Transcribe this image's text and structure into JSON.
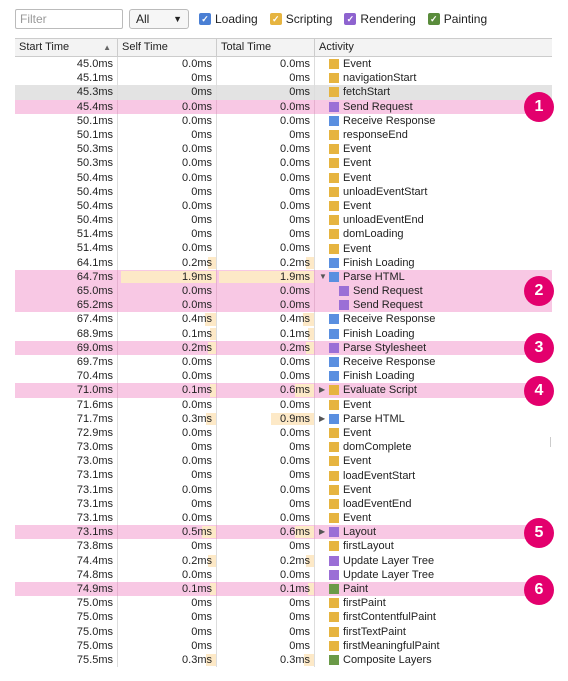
{
  "toolbar": {
    "filter_placeholder": "Filter",
    "select_value": "All",
    "categories": [
      {
        "label": "Loading",
        "color": "#4a7fd4"
      },
      {
        "label": "Scripting",
        "color": "#e6b440"
      },
      {
        "label": "Rendering",
        "color": "#8e63cf"
      },
      {
        "label": "Painting",
        "color": "#5a8c3c"
      }
    ]
  },
  "columns": {
    "start": "Start Time",
    "self": "Self Time",
    "total": "Total Time",
    "activity": "Activity"
  },
  "rows": [
    {
      "start": "45.0ms",
      "self": "0.0ms",
      "total": "0.0ms",
      "activity": "Event",
      "cat": "scripting"
    },
    {
      "start": "45.1ms",
      "self": "0ms",
      "total": "0ms",
      "activity": "navigationStart",
      "cat": "scripting"
    },
    {
      "start": "45.3ms",
      "self": "0ms",
      "total": "0ms",
      "activity": "fetchStart",
      "cat": "scripting",
      "sel": true
    },
    {
      "start": "45.4ms",
      "self": "0.0ms",
      "total": "0.0ms",
      "activity": "Send Request",
      "cat": "rendering",
      "hl": true
    },
    {
      "start": "50.1ms",
      "self": "0.0ms",
      "total": "0.0ms",
      "activity": "Receive Response",
      "cat": "loading"
    },
    {
      "start": "50.1ms",
      "self": "0ms",
      "total": "0ms",
      "activity": "responseEnd",
      "cat": "scripting"
    },
    {
      "start": "50.3ms",
      "self": "0.0ms",
      "total": "0.0ms",
      "activity": "Event",
      "cat": "scripting"
    },
    {
      "start": "50.3ms",
      "self": "0.0ms",
      "total": "0.0ms",
      "activity": "Event",
      "cat": "scripting"
    },
    {
      "start": "50.4ms",
      "self": "0.0ms",
      "total": "0.0ms",
      "activity": "Event",
      "cat": "scripting"
    },
    {
      "start": "50.4ms",
      "self": "0ms",
      "total": "0ms",
      "activity": "unloadEventStart",
      "cat": "scripting"
    },
    {
      "start": "50.4ms",
      "self": "0.0ms",
      "total": "0.0ms",
      "activity": "Event",
      "cat": "scripting"
    },
    {
      "start": "50.4ms",
      "self": "0ms",
      "total": "0ms",
      "activity": "unloadEventEnd",
      "cat": "scripting"
    },
    {
      "start": "51.4ms",
      "self": "0ms",
      "total": "0ms",
      "activity": "domLoading",
      "cat": "scripting"
    },
    {
      "start": "51.4ms",
      "self": "0.0ms",
      "total": "0.0ms",
      "activity": "Event",
      "cat": "scripting"
    },
    {
      "start": "64.1ms",
      "self": "0.2ms",
      "total": "0.2ms",
      "activity": "Finish Loading",
      "cat": "loading",
      "bar": 0.08
    },
    {
      "start": "64.7ms",
      "self": "1.9ms",
      "total": "1.9ms",
      "activity": "Parse HTML",
      "cat": "loading",
      "hl": true,
      "tri": "▼",
      "bar": 1.0
    },
    {
      "start": "65.0ms",
      "self": "0.0ms",
      "total": "0.0ms",
      "activity": "Send Request",
      "cat": "rendering",
      "hl": true,
      "indent": true
    },
    {
      "start": "65.2ms",
      "self": "0.0ms",
      "total": "0.0ms",
      "activity": "Send Request",
      "cat": "rendering",
      "hl": true,
      "indent": true
    },
    {
      "start": "67.4ms",
      "self": "0.4ms",
      "total": "0.4ms",
      "activity": "Receive Response",
      "cat": "loading",
      "bar": 0.12
    },
    {
      "start": "68.9ms",
      "self": "0.1ms",
      "total": "0.1ms",
      "activity": "Finish Loading",
      "cat": "loading",
      "bar": 0.05
    },
    {
      "start": "69.0ms",
      "self": "0.2ms",
      "total": "0.2ms",
      "activity": "Parse Stylesheet",
      "cat": "rendering",
      "hl": true,
      "bar": 0.08
    },
    {
      "start": "69.7ms",
      "self": "0.0ms",
      "total": "0.0ms",
      "activity": "Receive Response",
      "cat": "loading"
    },
    {
      "start": "70.4ms",
      "self": "0.0ms",
      "total": "0.0ms",
      "activity": "Finish Loading",
      "cat": "loading"
    },
    {
      "start": "71.0ms",
      "self": "0.1ms",
      "total": "0.6ms",
      "activity": "Evaluate Script",
      "cat": "scripting",
      "hl": true,
      "tri": "▶",
      "bar": 0.05,
      "tbar": 0.2
    },
    {
      "start": "71.6ms",
      "self": "0.0ms",
      "total": "0.0ms",
      "activity": "Event",
      "cat": "scripting"
    },
    {
      "start": "71.7ms",
      "self": "0.3ms",
      "total": "0.9ms",
      "activity": "Parse HTML",
      "cat": "loading",
      "tri": "▶",
      "bar": 0.1,
      "tbar": 0.45
    },
    {
      "start": "72.9ms",
      "self": "0.0ms",
      "total": "0.0ms",
      "activity": "Event",
      "cat": "scripting"
    },
    {
      "start": "73.0ms",
      "self": "0ms",
      "total": "0ms",
      "activity": "domComplete",
      "cat": "scripting"
    },
    {
      "start": "73.0ms",
      "self": "0.0ms",
      "total": "0.0ms",
      "activity": "Event",
      "cat": "scripting"
    },
    {
      "start": "73.1ms",
      "self": "0ms",
      "total": "0ms",
      "activity": "loadEventStart",
      "cat": "scripting"
    },
    {
      "start": "73.1ms",
      "self": "0.0ms",
      "total": "0.0ms",
      "activity": "Event",
      "cat": "scripting"
    },
    {
      "start": "73.1ms",
      "self": "0ms",
      "total": "0ms",
      "activity": "loadEventEnd",
      "cat": "scripting"
    },
    {
      "start": "73.1ms",
      "self": "0.0ms",
      "total": "0.0ms",
      "activity": "Event",
      "cat": "scripting"
    },
    {
      "start": "73.1ms",
      "self": "0.5ms",
      "total": "0.6ms",
      "activity": "Layout",
      "cat": "rendering",
      "hl": true,
      "tri": "▶",
      "bar": 0.15,
      "tbar": 0.2
    },
    {
      "start": "73.8ms",
      "self": "0ms",
      "total": "0ms",
      "activity": "firstLayout",
      "cat": "scripting"
    },
    {
      "start": "74.4ms",
      "self": "0.2ms",
      "total": "0.2ms",
      "activity": "Update Layer Tree",
      "cat": "rendering",
      "bar": 0.08
    },
    {
      "start": "74.8ms",
      "self": "0.0ms",
      "total": "0.0ms",
      "activity": "Update Layer Tree",
      "cat": "rendering"
    },
    {
      "start": "74.9ms",
      "self": "0.1ms",
      "total": "0.1ms",
      "activity": "Paint",
      "cat": "painting",
      "hl": true,
      "bar": 0.05
    },
    {
      "start": "75.0ms",
      "self": "0ms",
      "total": "0ms",
      "activity": "firstPaint",
      "cat": "scripting"
    },
    {
      "start": "75.0ms",
      "self": "0ms",
      "total": "0ms",
      "activity": "firstContentfulPaint",
      "cat": "scripting"
    },
    {
      "start": "75.0ms",
      "self": "0ms",
      "total": "0ms",
      "activity": "firstTextPaint",
      "cat": "scripting"
    },
    {
      "start": "75.0ms",
      "self": "0ms",
      "total": "0ms",
      "activity": "firstMeaningfulPaint",
      "cat": "scripting"
    },
    {
      "start": "75.5ms",
      "self": "0.3ms",
      "total": "0.3ms",
      "activity": "Composite Layers",
      "cat": "painting",
      "bar": 0.1
    }
  ],
  "badges": [
    {
      "label": "1",
      "row": 3
    },
    {
      "label": "2",
      "row": 16
    },
    {
      "label": "3",
      "row": 20
    },
    {
      "label": "4",
      "row": 23
    },
    {
      "label": "5",
      "row": 33
    },
    {
      "label": "6",
      "row": 37
    }
  ]
}
